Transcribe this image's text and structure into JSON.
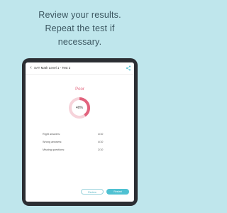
{
  "headline": {
    "line1": "Review your results.",
    "line2": "Repeat the test if",
    "line3": "necessary."
  },
  "app": {
    "title": "SAT Math Level 1 -  Test 2",
    "back_icon": "chevron-left-icon",
    "share_icon": "share-icon"
  },
  "result": {
    "grade": "Poor",
    "percent_label": "40%",
    "percent_value": 0.4,
    "ring_color": "#e2637d",
    "ring_track_color": "#f6d3da"
  },
  "stats": [
    {
      "label": "Right answers:",
      "value": "4/10"
    },
    {
      "label": "Wrong answers:",
      "value": "4/10"
    },
    {
      "label": "Missing questions:",
      "value": "2/10"
    }
  ],
  "buttons": {
    "secondary": "Review",
    "primary": "Restart"
  },
  "colors": {
    "background": "#bfe6ec",
    "accent": "#4fc1d2"
  }
}
